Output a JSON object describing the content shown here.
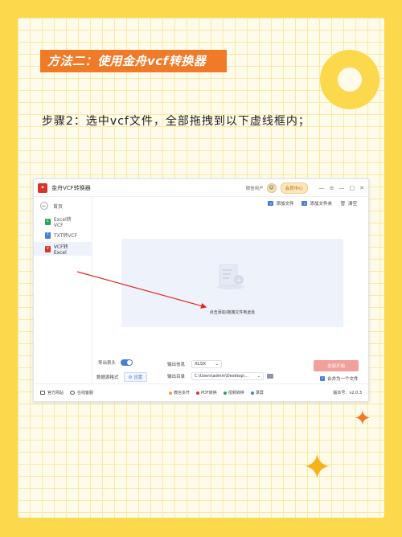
{
  "title_banner": "方法二：使用金舟vcf转换器",
  "step_text": "步骤2：选中vcf文件，全部拖拽到以下虚线框内；",
  "app": {
    "title": "金舟VCF转换器",
    "user_name": "微信用户",
    "vip_label": "会员中心",
    "controls": [
      "—",
      "≡",
      "—",
      "□",
      "✕"
    ],
    "home_label": "首页",
    "nav": [
      {
        "label": "Excel转VCF",
        "color": "#27a35a"
      },
      {
        "label": "TXT转VCF",
        "color": "#4a7bd9"
      },
      {
        "label": "VCF转Excel",
        "color": "#d9342b"
      }
    ],
    "toolbar": {
      "add_file": "添加文件",
      "add_folder": "添加文件夹",
      "clear": "清空"
    },
    "drop_hint": "点击添加/拖拽文件到此处",
    "export_header_label": "导出表头",
    "source_format_label": "数据源格式",
    "settings_label": "设置",
    "output_info_label": "输出信息",
    "output_format": "XLSX",
    "output_dir_label": "输出目录",
    "output_path": "C:\\Users\\admin\\Desktop\\...",
    "convert_label": "全部开始",
    "merge_label": "合并为一个文件",
    "status": {
      "website": "官方网站",
      "service": "在线客服",
      "links": [
        {
          "label": "微信多开",
          "color": "#f0a13c"
        },
        {
          "label": "PDF转换",
          "color": "#d9342b"
        },
        {
          "label": "视频转换",
          "color": "#27a35a"
        },
        {
          "label": "录屏",
          "color": "#4a7bd9"
        }
      ],
      "version": "版本号：v2.0.3"
    }
  }
}
